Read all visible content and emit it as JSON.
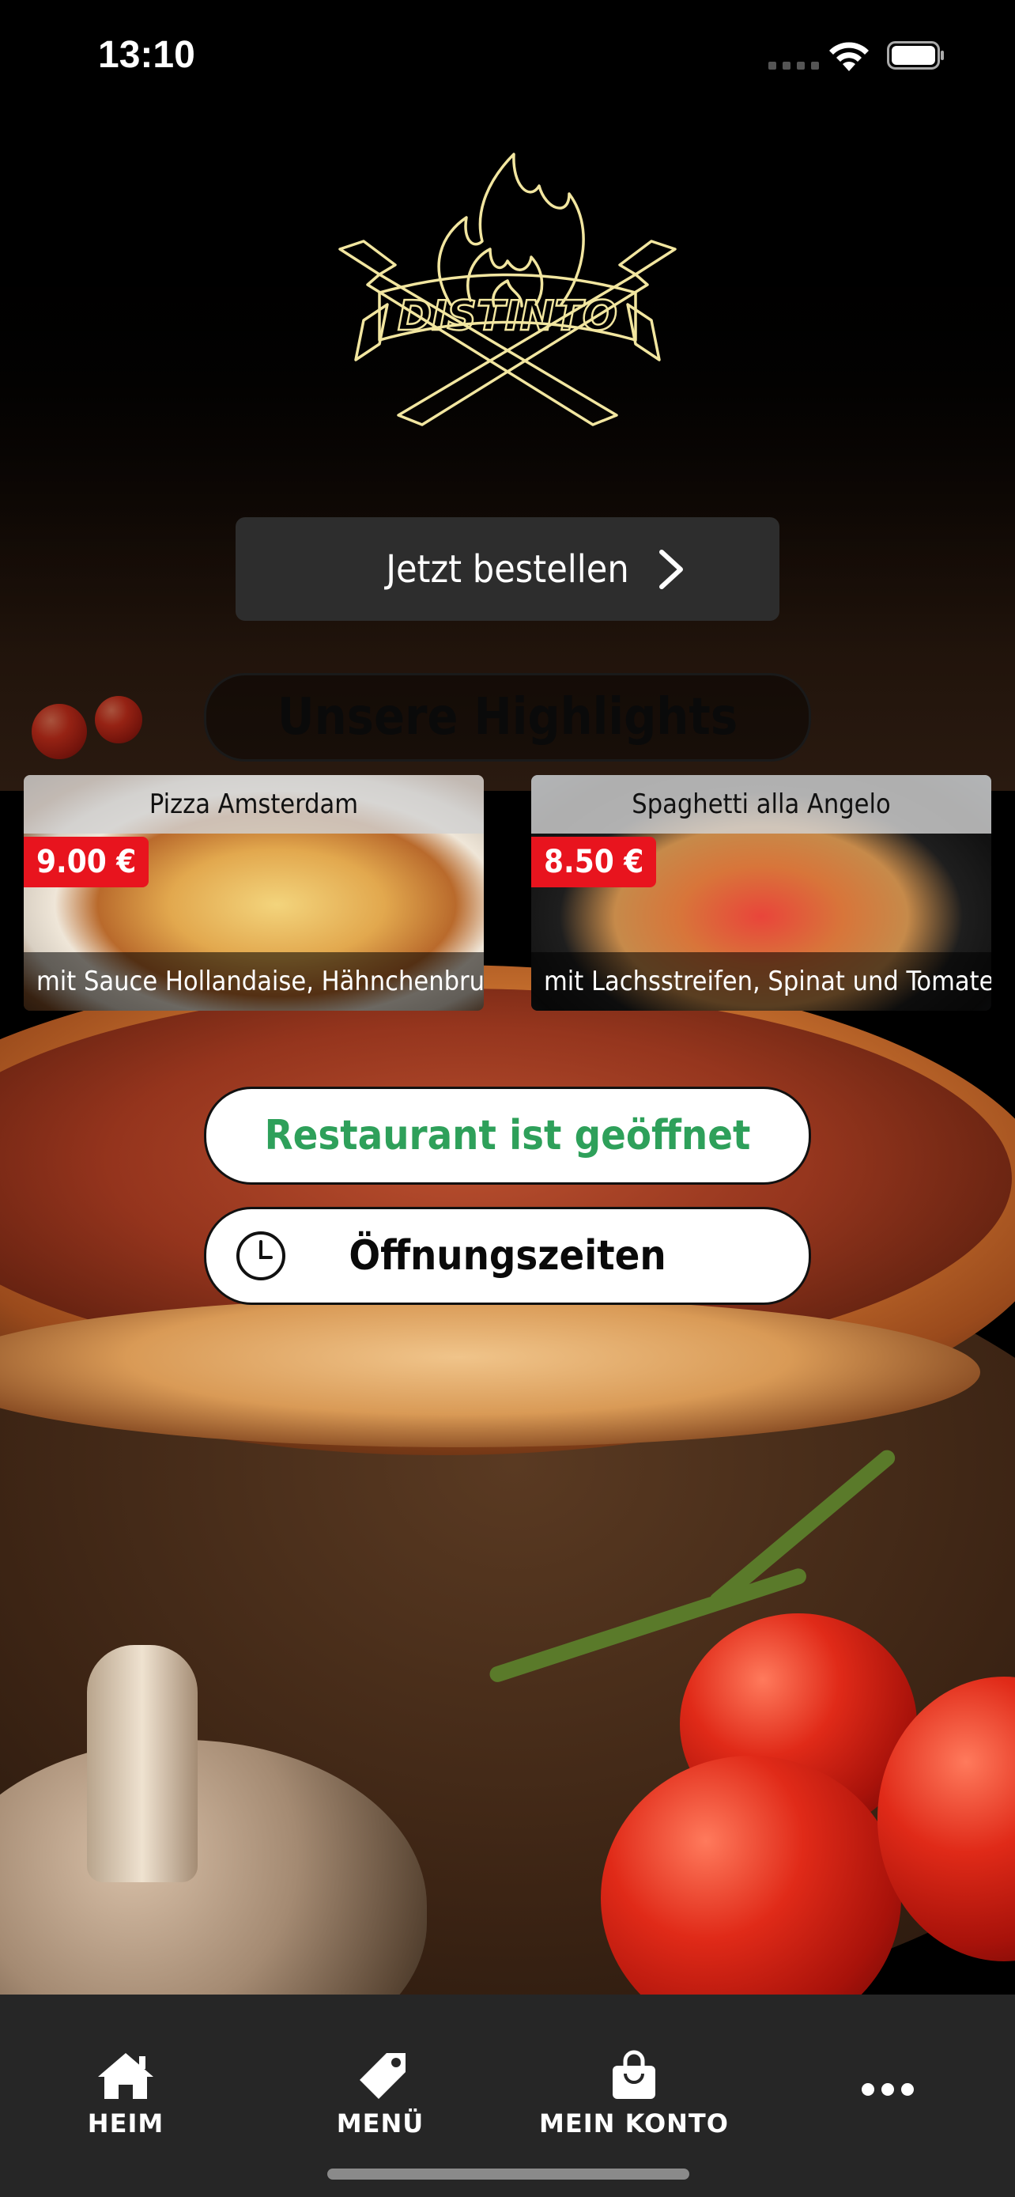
{
  "status_bar": {
    "time": "13:10"
  },
  "brand": {
    "name": "DISTINTO"
  },
  "actions": {
    "order_now": "Jetzt bestellen"
  },
  "highlights": {
    "title": "Unsere Highlights",
    "items": [
      {
        "name": "Pizza Amsterdam",
        "price": "9.00 €",
        "description": "mit Sauce Hollandaise, Hähnchenbrustfile..."
      },
      {
        "name": "Spaghetti alla Angelo",
        "price": "8.50 €",
        "description": "mit Lachsstreifen, Spinat und Tomaten-S..."
      }
    ]
  },
  "restaurant": {
    "status": "Restaurant ist geöffnet",
    "hours_label": "Öffnungszeiten"
  },
  "tabbar": {
    "items": [
      {
        "label": "HEIM",
        "icon": "home-icon"
      },
      {
        "label": "MENÜ",
        "icon": "tag-icon"
      },
      {
        "label": "MEIN KONTO",
        "icon": "shopping-bag-icon"
      },
      {
        "label": "",
        "icon": "more-icon"
      }
    ]
  },
  "colors": {
    "accent_green": "#2ea05a",
    "price_red": "#e8141e",
    "logo_gold": "#f2e6a0",
    "tabbar_bg": "#262626",
    "button_bg": "#2d2d2d"
  }
}
